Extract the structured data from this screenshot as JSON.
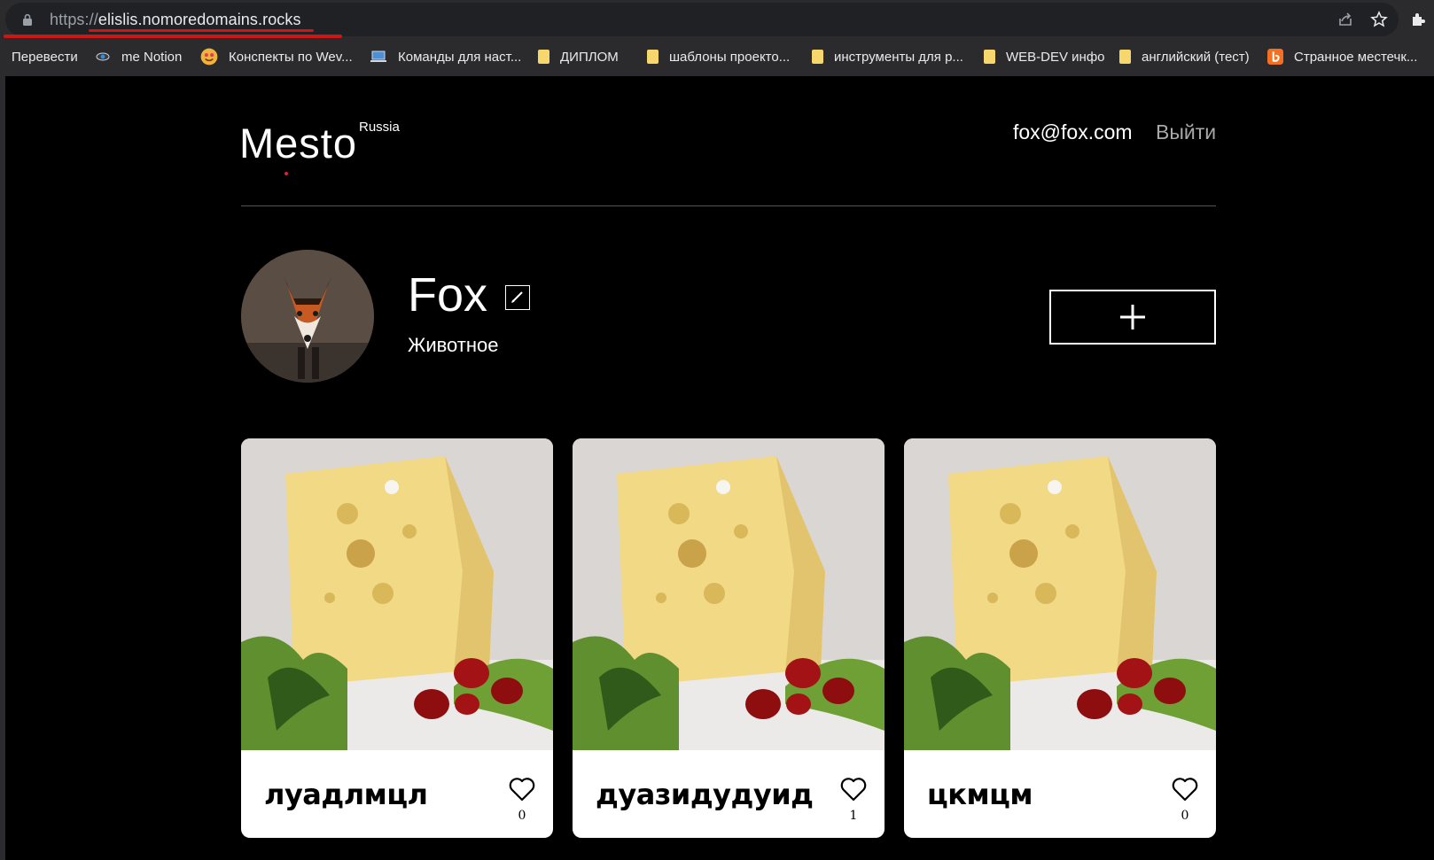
{
  "browser": {
    "url_scheme": "https://",
    "url_host": "elislis.nomoredomains.rocks",
    "bookmarks": [
      {
        "label": "Перевести",
        "icon": "none"
      },
      {
        "label": "me Notion",
        "icon": "eye-icon"
      },
      {
        "label": "Конспекты по Wev...",
        "icon": "emoji-icon"
      },
      {
        "label": "Команды для наст...",
        "icon": "laptop-icon"
      },
      {
        "label": "ДИПЛОМ",
        "icon": "folder-icon"
      },
      {
        "label": "шаблоны проекто...",
        "icon": "folder-icon"
      },
      {
        "label": "инструменты для р...",
        "icon": "folder-icon"
      },
      {
        "label": "WEB-DEV инфо",
        "icon": "folder-icon"
      },
      {
        "label": "английский (тест)",
        "icon": "folder-icon"
      },
      {
        "label": "Странное местечк...",
        "icon": "orange-logo-icon"
      }
    ]
  },
  "header": {
    "logo": "Mesto",
    "logo_sup": "Russia",
    "email": "fox@fox.com",
    "logout": "Выйти"
  },
  "profile": {
    "name": "Fox",
    "about": "Животное"
  },
  "cards": [
    {
      "title": "луадлмцл",
      "likes": "0"
    },
    {
      "title": "дуазидудуид",
      "likes": "1"
    },
    {
      "title": "цкмцм",
      "likes": "0"
    }
  ],
  "colors": {
    "page_bg": "#000000",
    "chrome_bg": "#2b2b2d",
    "url_underline": "#d01515",
    "logout": "#a9a9a9"
  }
}
